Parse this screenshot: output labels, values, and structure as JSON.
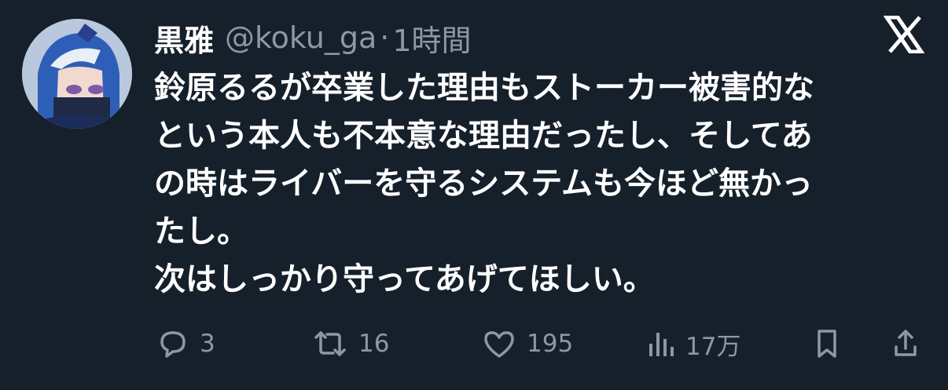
{
  "user": {
    "display_name": "黒雅",
    "handle": "@koku_ga",
    "separator": "·",
    "time": "1時間"
  },
  "tweet": {
    "text": "鈴原るるが卒業した理由もストーカー被害的な\nという本人も不本意な理由だったし、そしてあ\nの時はライバーを守るシステムも今ほど無かっ\nたし。\n次はしっかり守ってあげてほしい。"
  },
  "actions": {
    "reply_count": "3",
    "retweet_count": "16",
    "like_count": "195",
    "view_count": "17万"
  },
  "icons": {
    "brand": "x-logo-icon",
    "reply": "reply-icon",
    "retweet": "retweet-icon",
    "like": "heart-icon",
    "views": "views-icon",
    "bookmark": "bookmark-icon",
    "share": "share-icon"
  },
  "colors": {
    "background": "#15202b",
    "text": "#ffffff",
    "secondary_text": "#8b98a5"
  }
}
